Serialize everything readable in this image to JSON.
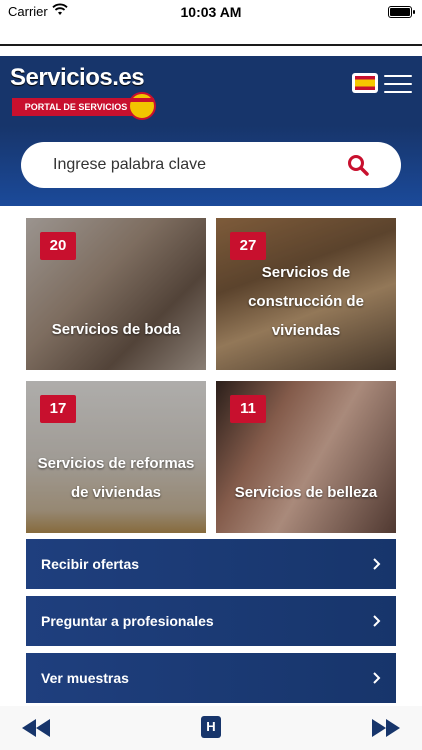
{
  "statusbar": {
    "carrier": "Carrier",
    "time": "10:03 AM"
  },
  "header": {
    "logo_title": "Servicios.es",
    "logo_subtitle": "PORTAL DE SERVICIOS",
    "flag_icon": "spain-flag-icon",
    "menu_icon": "hamburger-menu-icon"
  },
  "search": {
    "placeholder": "Ingrese palabra clave",
    "value": ""
  },
  "categories": [
    {
      "count": "20",
      "label": "Servicios de boda"
    },
    {
      "count": "27",
      "label": "Servicios de construcción de viviendas"
    },
    {
      "count": "17",
      "label": "Servicios de reformas de viviendas"
    },
    {
      "count": "11",
      "label": "Servicios de belleza"
    }
  ],
  "menu": [
    {
      "label": "Recibir ofertas"
    },
    {
      "label": "Preguntar a profesionales"
    },
    {
      "label": "Ver muestras"
    }
  ],
  "bottom_nav": {
    "home_label": "H"
  },
  "colors": {
    "brand_blue": "#17356b",
    "accent_red": "#c8102e"
  }
}
